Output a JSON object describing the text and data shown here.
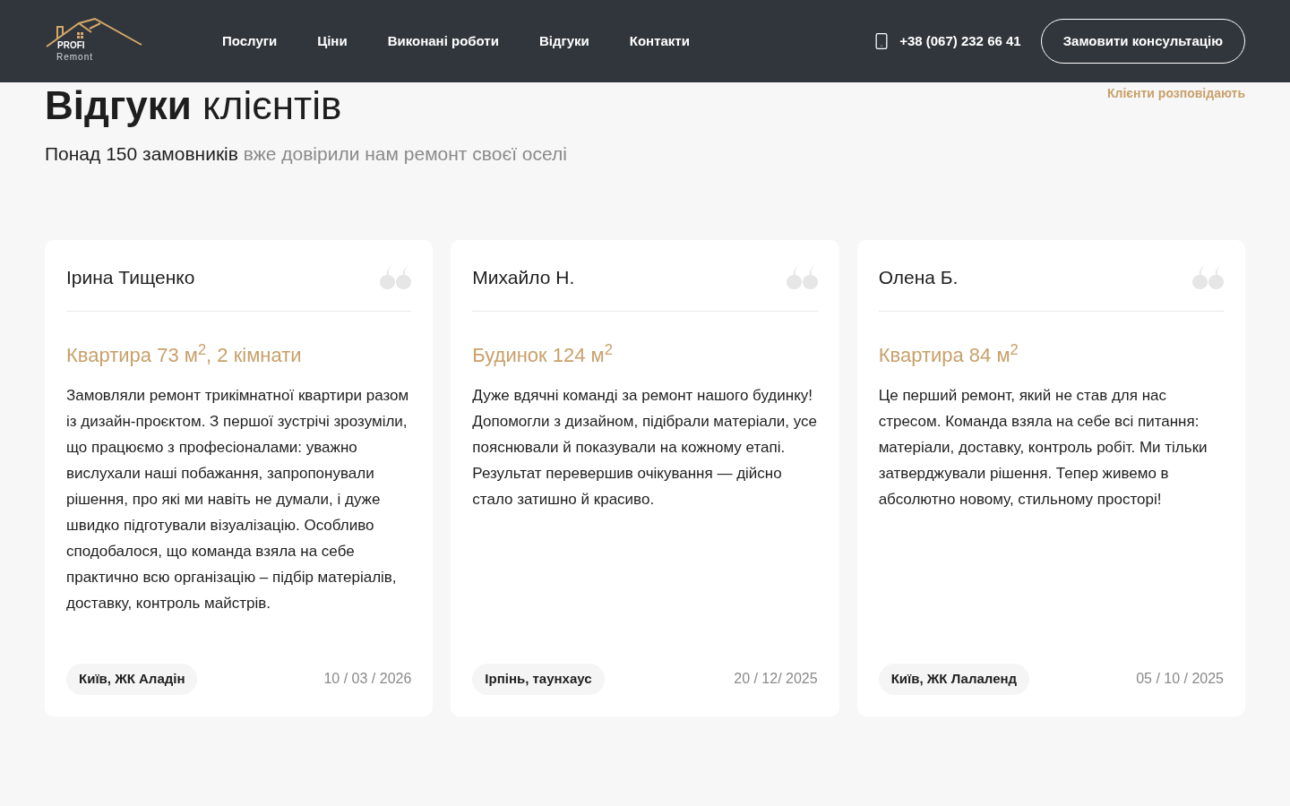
{
  "header": {
    "logo": {
      "line_1": "PROFI",
      "line_2": "Remont"
    },
    "nav": [
      {
        "label": "Послуги"
      },
      {
        "label": "Ціни"
      },
      {
        "label": "Виконані роботи"
      },
      {
        "label": "Відгуки"
      },
      {
        "label": "Контакти"
      }
    ],
    "phone": "+38 (067) 232 66 41",
    "cta": "Замовити консультацію"
  },
  "section": {
    "eyebrow": "Клієнти розповідають",
    "title_bold": "Відгуки",
    "title_rest": "клієнтів",
    "subtitle_lead": "Понад 150 замовників",
    "subtitle_rest": "вже довірили нам ремонт своєї оселі"
  },
  "reviews": [
    {
      "name": "Ірина Тищенко",
      "title": "Квартира 73 м$^{2}$, 2 кімнати",
      "text": "Замовляли ремонт трикімнатної квартири разом із дизайн-проєктом. З першої зустрічі зрозуміли, що працюємо з професіоналами: уважно вислухали наші побажання, запропонували рішення, про які ми навіть не думали, і дуже швидко підготували візуалізацію. Особливо сподобалося, що команда взяла на себе практично всю організацію – підбір матеріалів, доставку, контроль майстрів.",
      "location": "Київ, ЖК Аладін",
      "date": "10 / 03 / 2026"
    },
    {
      "name": "Михайло Н.",
      "title": "Будинок 124 м$^{2}$",
      "text": "Дуже вдячні команді за ремонт нашого будинку! Допомогли з дизайном, підібрали матеріали, усе пояснювали й показували на кожному етапі. Результат перевершив очікування — дійсно стало затишно й красиво.",
      "location": "Ірпінь, таунхаус",
      "date": "20 / 12/ 2025"
    },
    {
      "name": "Олена Б.",
      "title": "Квартира 84 м$^{2}$",
      "text": "Це перший ремонт, який не став для нас стресом. Команда взяла на себе всі питання: матеріали, доставку, контроль робіт. Ми тільки затверджували рішення. Тепер живемо в абсолютно новому, стильному просторі!",
      "location": "Київ, ЖК Лалаленд",
      "date": "05 / 10 / 2025"
    }
  ]
}
